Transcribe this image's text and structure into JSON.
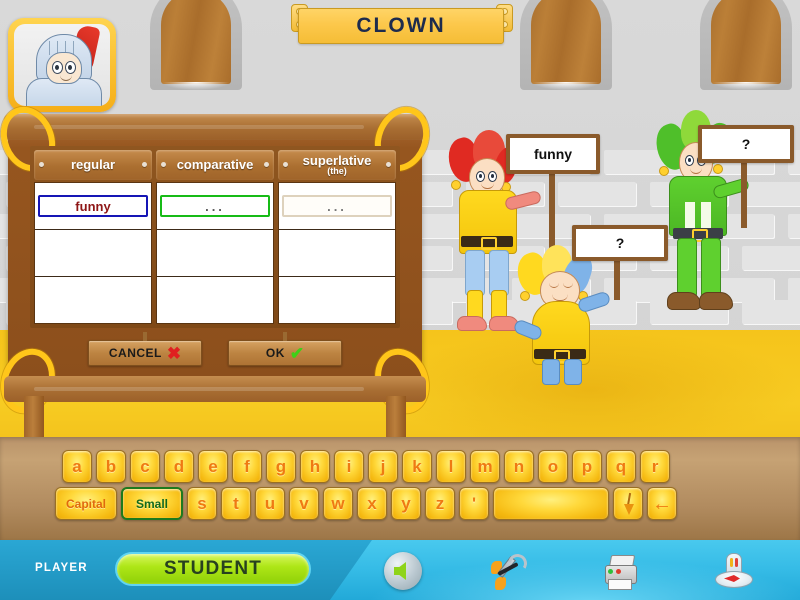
{
  "app": {
    "title": "CLOWN",
    "avatar_name": "knight-avatar"
  },
  "board": {
    "columns": [
      {
        "label": "regular",
        "sub": ""
      },
      {
        "label": "comparative",
        "sub": ""
      },
      {
        "label": "superlative",
        "sub": "(the)"
      }
    ],
    "rows": [
      {
        "regular": {
          "value": "funny",
          "state": "filled"
        },
        "comparative": {
          "value": "...",
          "state": "active"
        },
        "superlative": {
          "value": "...",
          "state": "pending"
        }
      },
      {
        "regular": {
          "value": "",
          "state": "empty"
        },
        "comparative": {
          "value": "",
          "state": "empty"
        },
        "superlative": {
          "value": "",
          "state": "empty"
        }
      },
      {
        "regular": {
          "value": "",
          "state": "empty"
        },
        "comparative": {
          "value": "",
          "state": "empty"
        },
        "superlative": {
          "value": "",
          "state": "empty"
        }
      }
    ],
    "buttons": {
      "cancel_label": "CANCEL",
      "cancel_mark": "✖",
      "ok_label": "OK",
      "ok_mark": "✔"
    }
  },
  "characters": [
    {
      "name": "jester-red",
      "sign_text": "funny"
    },
    {
      "name": "jester-blue",
      "sign_text": "?"
    },
    {
      "name": "jester-green",
      "sign_text": "?"
    }
  ],
  "keyboard": {
    "row1": [
      "a",
      "b",
      "c",
      "d",
      "e",
      "f",
      "g",
      "h",
      "i",
      "j",
      "k",
      "l",
      "m",
      "n",
      "o",
      "p",
      "q",
      "r"
    ],
    "row2_prefix": [
      {
        "label": "Capital",
        "name": "capital-key",
        "selected": false
      },
      {
        "label": "Small",
        "name": "small-key",
        "selected": true
      }
    ],
    "row2_letters": [
      "s",
      "t",
      "u",
      "v",
      "w",
      "x",
      "y",
      "z",
      "'"
    ],
    "row2_suffix": [
      {
        "label": "",
        "name": "space-key",
        "icon": "space"
      },
      {
        "label": "",
        "name": "clear-key",
        "icon": "broom"
      },
      {
        "label": "←",
        "name": "backspace-key",
        "icon": "arrow-left"
      }
    ]
  },
  "statusbar": {
    "player_label": "PLAYER",
    "player_name": "STUDENT",
    "tools": [
      {
        "name": "back-button",
        "icon": "back-arrow-icon"
      },
      {
        "name": "settings-button",
        "icon": "tools-icon"
      },
      {
        "name": "print-button",
        "icon": "printer-icon"
      },
      {
        "name": "map-button",
        "icon": "compass-icon"
      }
    ]
  },
  "colors": {
    "banner_text": "#1d2b4d",
    "filled_border": "#1515b5",
    "filled_text": "#8e1616",
    "active_border": "#17bb17",
    "pending_border": "#ded2bd",
    "key_letter": "#ef7a12",
    "selected_key_border": "#1d7a1d",
    "player_pill": "#aee617",
    "statusbar": "#2fb6e0",
    "ground": "#f5c41b"
  }
}
